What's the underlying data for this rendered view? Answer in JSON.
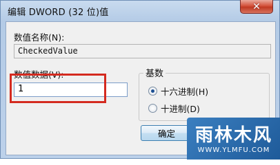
{
  "window": {
    "title": "编辑 DWORD (32 位)值",
    "close_glyph": "✕"
  },
  "value_name": {
    "label": "数值名称(N):",
    "value": "CheckedValue"
  },
  "value_data": {
    "label": "数值数据(V):",
    "value": "1",
    "highlight_color": "#d42a1f"
  },
  "base": {
    "title": "基数",
    "options": [
      {
        "label": "十六进制(H)",
        "selected": true
      },
      {
        "label": "十进制(D)",
        "selected": false
      }
    ]
  },
  "buttons": {
    "ok": "确定"
  },
  "watermark": {
    "text": "雨林木风",
    "url": "WWW.YLMFU.COM"
  }
}
